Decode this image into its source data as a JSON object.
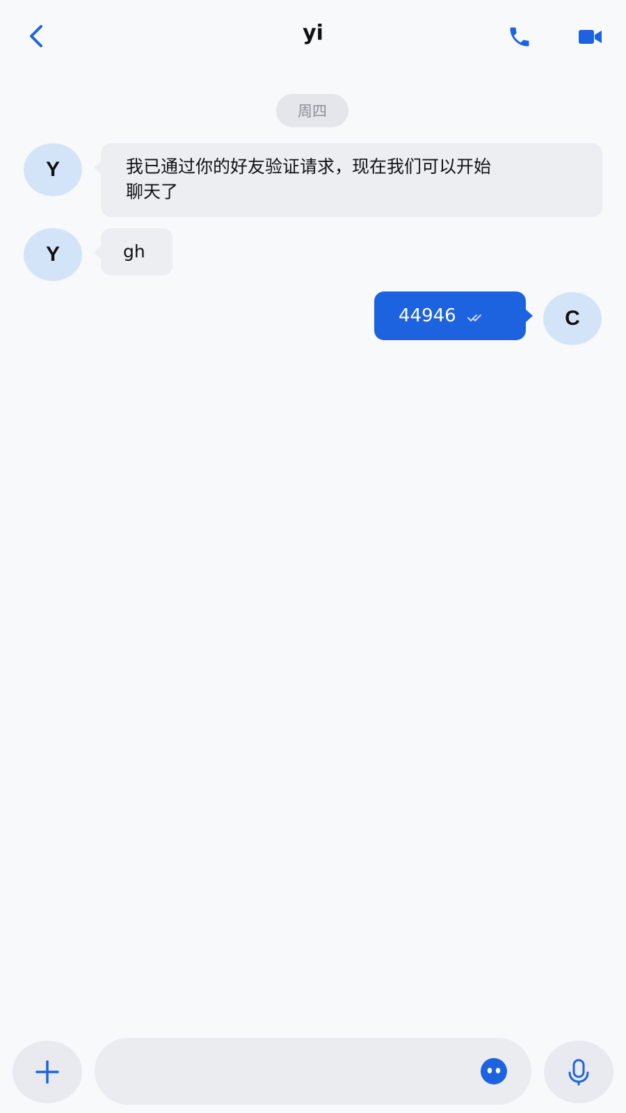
{
  "header": {
    "title": "yi",
    "back_icon": "chevron-left-icon",
    "call_icon": "phone-icon",
    "video_icon": "video-camera-icon"
  },
  "date_separator": "周四",
  "messages": [
    {
      "sender": "incoming",
      "avatar_letter": "Y",
      "text_line1": "我已通过你的好友验证请求，现在我们可以开始",
      "text_line2": "聊天了"
    },
    {
      "sender": "incoming",
      "avatar_letter": "Y",
      "text": "gh"
    },
    {
      "sender": "outgoing",
      "avatar_letter": "C",
      "text": "44946",
      "status_icon": "double-check-icon"
    }
  ],
  "composer": {
    "input_value": "",
    "input_placeholder": "",
    "plus_icon": "plus-icon",
    "emoji_icon": "emoji-icon",
    "mic_icon": "microphone-icon"
  },
  "colors": {
    "accent": "#1d63e0",
    "background": "#f8f9fb",
    "incoming_bubble": "#eceef2",
    "avatar_bg": "#d4e4f8",
    "date_chip_bg": "#e4e6eb"
  }
}
